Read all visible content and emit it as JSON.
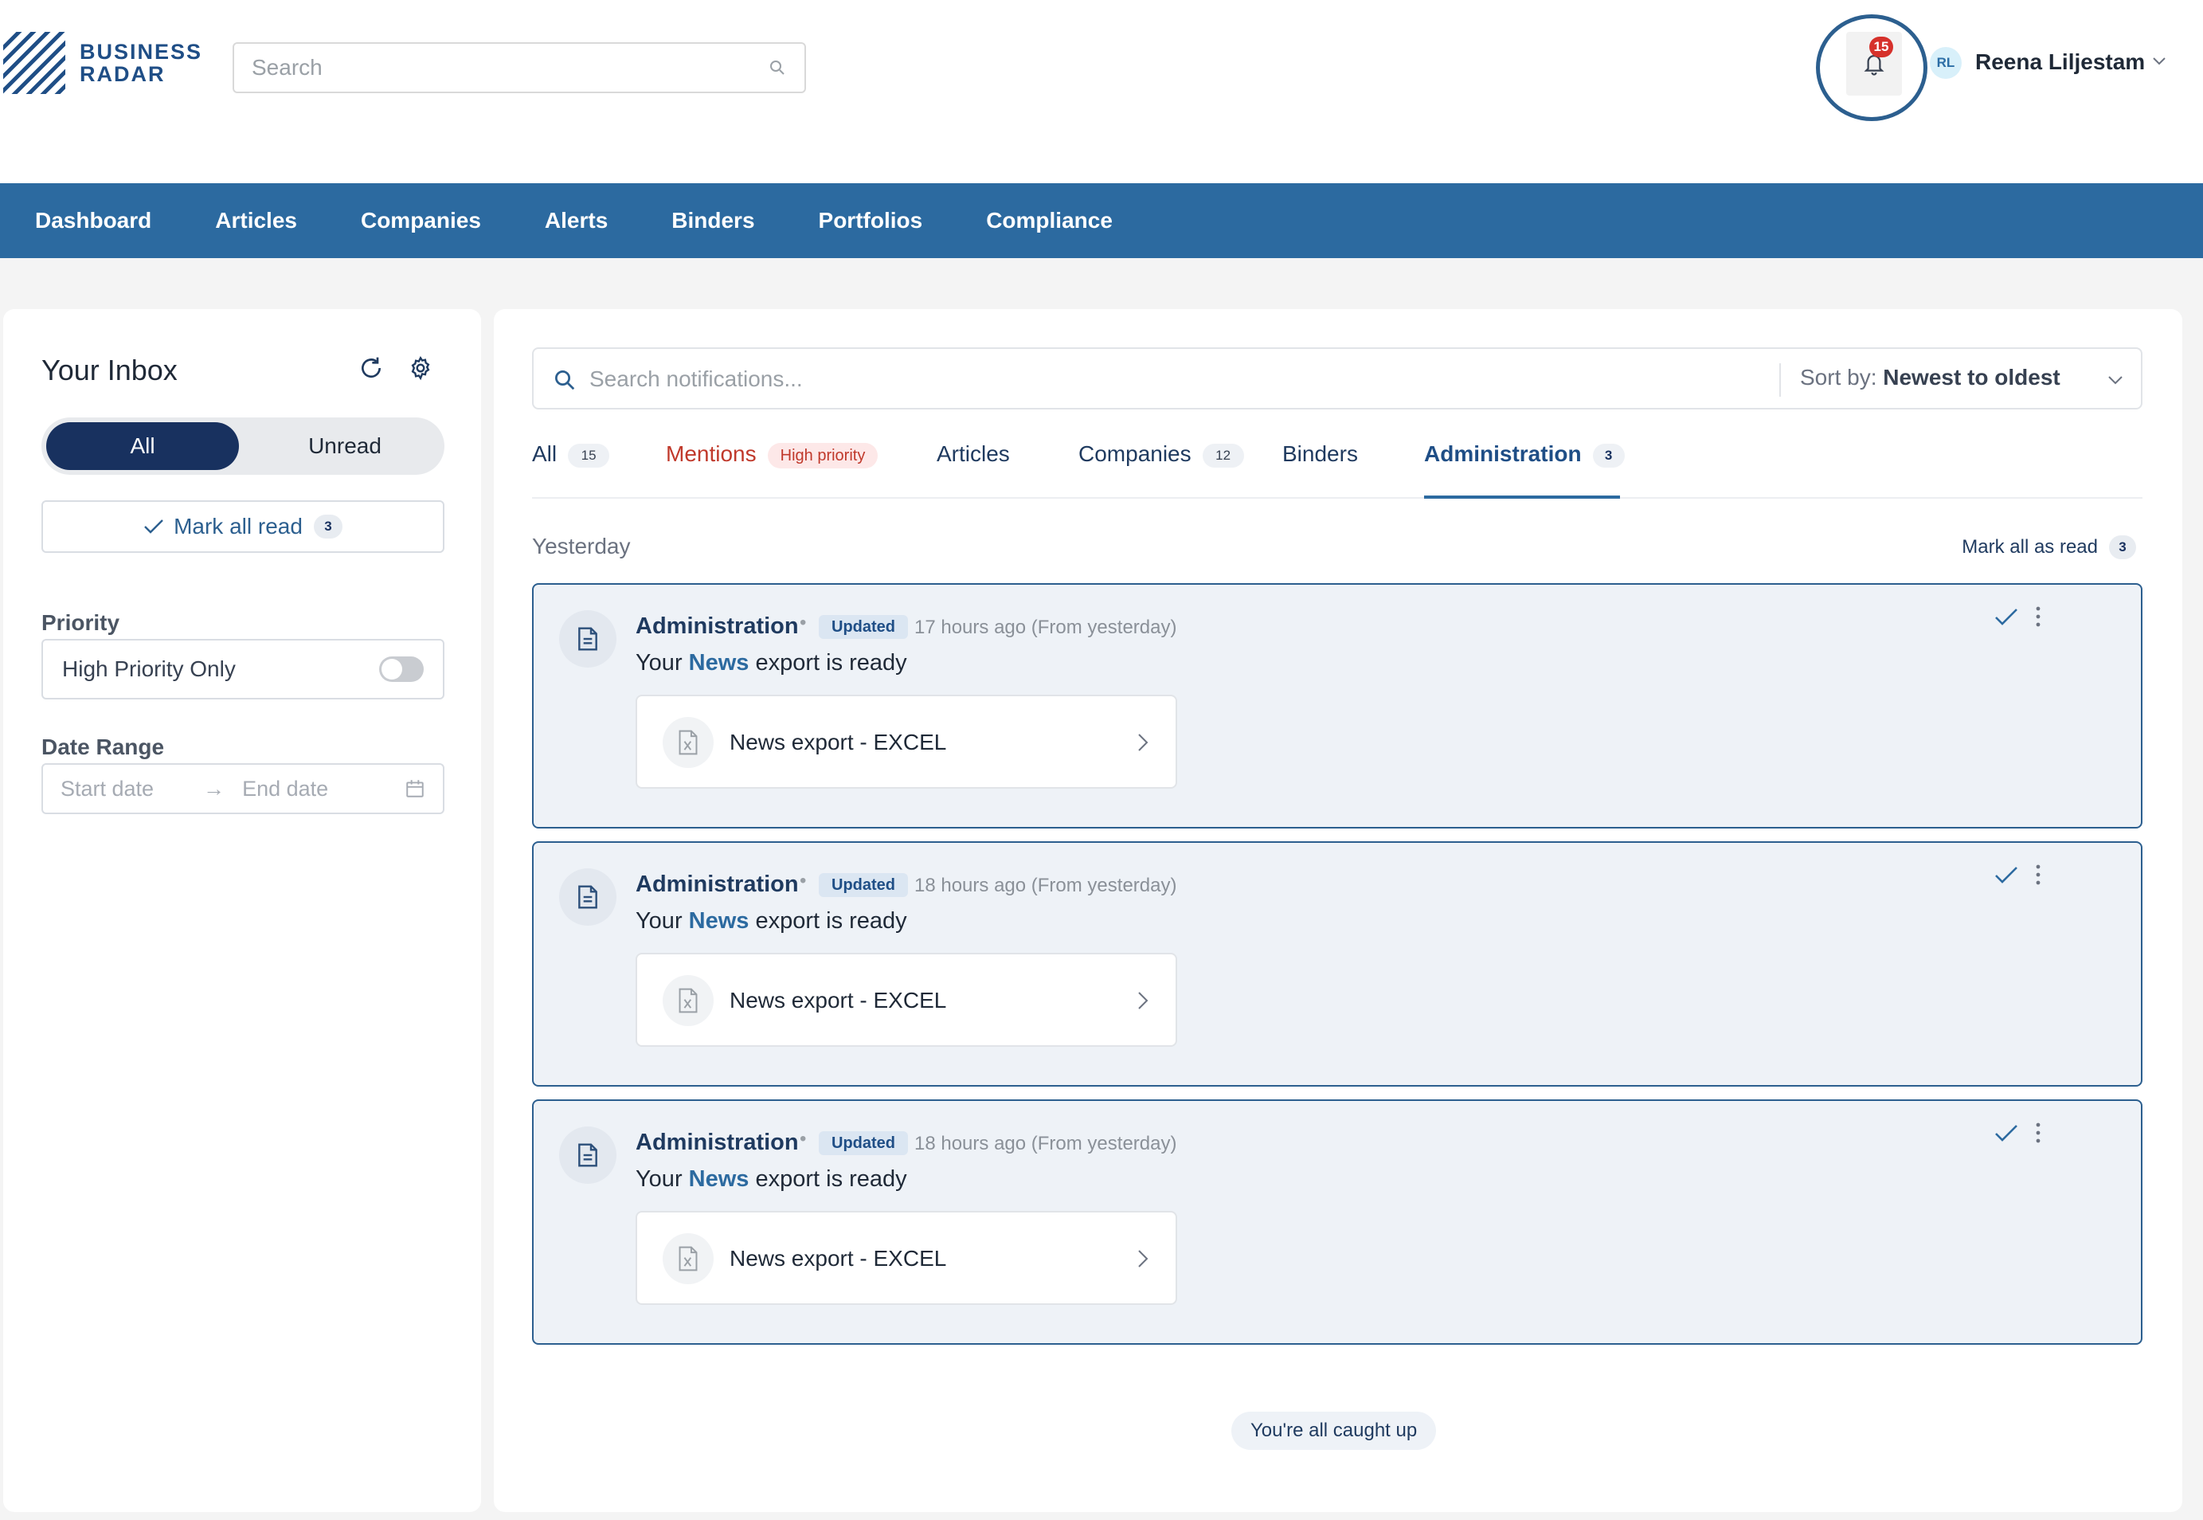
{
  "brand": {
    "name_line1": "BUSINESS",
    "name_line2": "RADAR",
    "color": "#1f4e86"
  },
  "search": {
    "placeholder": "Search",
    "icon": "search-icon"
  },
  "notifications": {
    "badge_count": "15",
    "badge_color": "#d6312b",
    "icon": "bell-icon"
  },
  "user": {
    "initials": "RL",
    "name": "Reena Liljestam"
  },
  "nav": {
    "color": "#2c6aa0",
    "items": [
      "Dashboard",
      "Articles",
      "Companies",
      "Alerts",
      "Binders",
      "Portfolios",
      "Compliance"
    ]
  },
  "inbox": {
    "title": "Your Inbox",
    "toggle": {
      "all": "All",
      "unread": "Unread",
      "selected": "All"
    },
    "mark_all_read": {
      "label": "Mark all read",
      "count": "3"
    },
    "priority": {
      "label": "Priority",
      "option": "High Priority Only",
      "enabled": false
    },
    "date_range": {
      "label": "Date Range",
      "start_placeholder": "Start date",
      "arrow": "→",
      "end_placeholder": "End date"
    }
  },
  "notif_search": {
    "placeholder": "Search notifications...",
    "sort_label": "Sort by:",
    "sort_value": "Newest to oldest"
  },
  "tabs": {
    "all": {
      "label": "All",
      "count": "15"
    },
    "mentions": {
      "label": "Mentions",
      "tag": "High priority"
    },
    "articles": {
      "label": "Articles"
    },
    "companies": {
      "label": "Companies",
      "count": "12"
    },
    "binders": {
      "label": "Binders"
    },
    "administration": {
      "label": "Administration",
      "count": "3"
    },
    "active": "Administration"
  },
  "group": {
    "label": "Yesterday",
    "mark_label": "Mark all as read",
    "mark_count": "3"
  },
  "cards": [
    {
      "title": "Administration",
      "dot": "•",
      "badge": "Updated",
      "time": "17 hours ago (From yesterday)",
      "msg_prefix": "Your ",
      "msg_highlight": "News",
      "msg_suffix": " export is ready",
      "attachment": "News export - EXCEL"
    },
    {
      "title": "Administration",
      "dot": "•",
      "badge": "Updated",
      "time": "18 hours ago (From yesterday)",
      "msg_prefix": "Your ",
      "msg_highlight": "News",
      "msg_suffix": " export is ready",
      "attachment": "News export - EXCEL"
    },
    {
      "title": "Administration",
      "dot": "•",
      "badge": "Updated",
      "time": "18 hours ago (From yesterday)",
      "msg_prefix": "Your ",
      "msg_highlight": "News",
      "msg_suffix": " export is ready",
      "attachment": "News export - EXCEL"
    }
  ],
  "footer": {
    "caught_up": "You're all caught up"
  }
}
